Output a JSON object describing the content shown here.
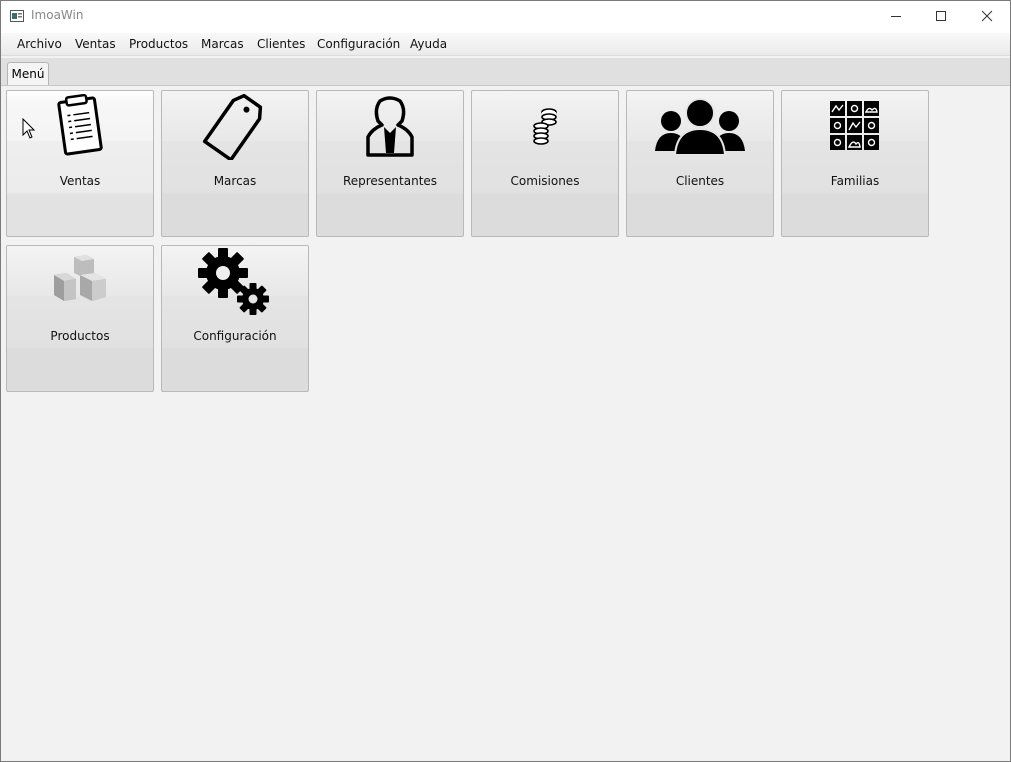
{
  "window": {
    "title": "ImoaWin"
  },
  "menubar": {
    "items": [
      {
        "label": "Archivo"
      },
      {
        "label": "Ventas"
      },
      {
        "label": "Productos"
      },
      {
        "label": "Marcas"
      },
      {
        "label": "Clientes"
      },
      {
        "label": "Configuración"
      },
      {
        "label": "Ayuda"
      }
    ]
  },
  "tabs": [
    {
      "label": "Menú",
      "selected": true
    }
  ],
  "tiles": [
    {
      "label": "Ventas",
      "icon": "clipboard-icon"
    },
    {
      "label": "Marcas",
      "icon": "tag-icon"
    },
    {
      "label": "Representantes",
      "icon": "person-tie-icon"
    },
    {
      "label": "Comisiones",
      "icon": "coin-stack-icon"
    },
    {
      "label": "Clientes",
      "icon": "group-people-icon"
    },
    {
      "label": "Familias",
      "icon": "image-grid-icon"
    },
    {
      "label": "Productos",
      "icon": "boxes-icon"
    },
    {
      "label": "Configuración",
      "icon": "gears-icon"
    }
  ]
}
